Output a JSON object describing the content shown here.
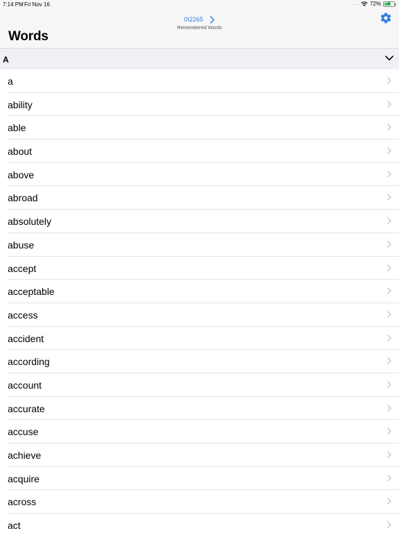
{
  "status_bar": {
    "time": "7:14 PM",
    "date": "Fri Nov 16",
    "signal": ".....",
    "battery_percent": "72%",
    "battery_level": 0.72
  },
  "nav": {
    "count": "0\\2265",
    "subtitle": "Remembered Words",
    "title": "Words",
    "accent_color": "#2f7de1"
  },
  "section": {
    "letter": "A"
  },
  "words": [
    "a",
    "ability",
    "able",
    "about",
    "above",
    "abroad",
    "absolutely",
    "abuse",
    "accept",
    "acceptable",
    "access",
    "accident",
    "according",
    "account",
    "accurate",
    "accuse",
    "achieve",
    "acquire",
    "across",
    "act"
  ]
}
